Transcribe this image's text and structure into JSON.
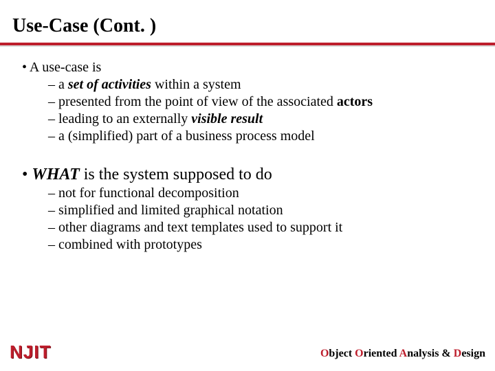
{
  "title": "Use-Case (Cont. )",
  "block1": {
    "lead": "A use-case is",
    "items": [
      {
        "pre": "a ",
        "em": "set of activities",
        "post": " within a system"
      },
      {
        "pre": "presented from the point of view of the associated ",
        "em": "actors",
        "post": ""
      },
      {
        "pre": "leading to an externally ",
        "em": "visible result",
        "post": ""
      },
      {
        "pre": "a (simplified) part of a business process model",
        "em": "",
        "post": ""
      }
    ]
  },
  "block2": {
    "lead_em": "WHAT",
    "lead_rest": " is the system supposed to do",
    "items": [
      "not for functional decomposition",
      "simplified and limited graphical notation",
      "other diagrams and text templates used to support it",
      "combined with prototypes"
    ]
  },
  "footer": {
    "logo": "NJIT",
    "course": {
      "o1": "O",
      "t1": "bject ",
      "o2": "O",
      "t2": "riented ",
      "a": "A",
      "t3": "nalysis & ",
      "d": "D",
      "t4": "esign"
    }
  }
}
